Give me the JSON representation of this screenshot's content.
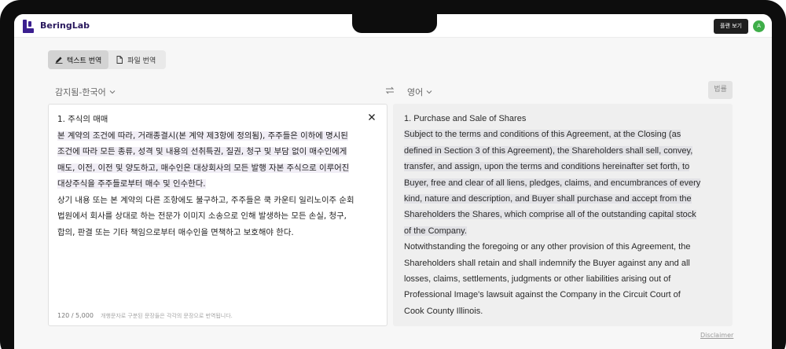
{
  "app": {
    "brand": "BeringLab"
  },
  "header": {
    "plan_button": "플랜 보기",
    "avatar_initial": "A"
  },
  "tabs": [
    {
      "label": "텍스트 번역",
      "active": true,
      "icon": "pencil-icon"
    },
    {
      "label": "파일 번역",
      "active": false,
      "icon": "file-icon"
    }
  ],
  "source_lang": "감지됨-한국어",
  "target_lang": "영어",
  "glossary_button": "법률",
  "source": {
    "paragraphs": [
      {
        "text": "1.  주식의 매매",
        "highlight": false
      },
      {
        "text": "본 계약의 조건에 따라, 거래종결시(본 계약 제3항에 정의됨), 주주들은 이하에 명시된 조건에 따라 모든 종류, 성격 및 내용의 선취특권, 질권, 청구 및 부담 없이 매수인에게 매도, 이전, 이전 및 양도하고, 매수인은 대상회사의 모든 발행 자본 주식으로 이루어진 대상주식을 주주들로부터 매수 및 인수한다.",
        "highlight": true
      },
      {
        "text": "상기 내용 또는 본 계약의 다른 조항에도 불구하고, 주주들은 쿡 카운티 일리노이주 순회법원에서 회사를 상대로 하는 전문가 이미지 소송으로 인해 발생하는 모든 손실, 청구, 합의, 판결 또는 기타 책임으로부터 매수인을 면책하고 보호해야 한다.",
        "highlight": false
      }
    ],
    "counter": "120 / 5,000",
    "hint": "개행문자로 구분된 문장들은 각각의 문장으로 번역됩니다."
  },
  "target": {
    "paragraphs": [
      {
        "text": "1. Purchase and Sale of Shares",
        "highlight": false
      },
      {
        "text": "Subject to the terms and conditions of this Agreement, at the Closing (as defined in Section 3 of this Agreement), the Shareholders shall sell, convey, transfer, and assign, upon the terms and conditions hereinafter set forth, to Buyer, free and clear of all liens, pledges, claims, and encumbrances of every kind, nature and description, and Buyer shall purchase and accept from the Shareholders the Shares, which comprise all of the outstanding capital stock of the Company.",
        "highlight": true
      },
      {
        "text": "Notwithstanding the foregoing or any other provision of this Agreement, the Shareholders shall retain and shall indemnify the Buyer against any and all losses, claims, settlements, judgments or other liabilities arising out of Professional Image's lawsuit against the Company in the Circuit Court of Cook County Illinois.",
        "highlight": false
      }
    ]
  },
  "disclaimer": "Disclaimer",
  "colors": {
    "brand": "#3b1f8f",
    "avatar": "#3fae49",
    "plan_button_bg": "#1f1f1f"
  }
}
